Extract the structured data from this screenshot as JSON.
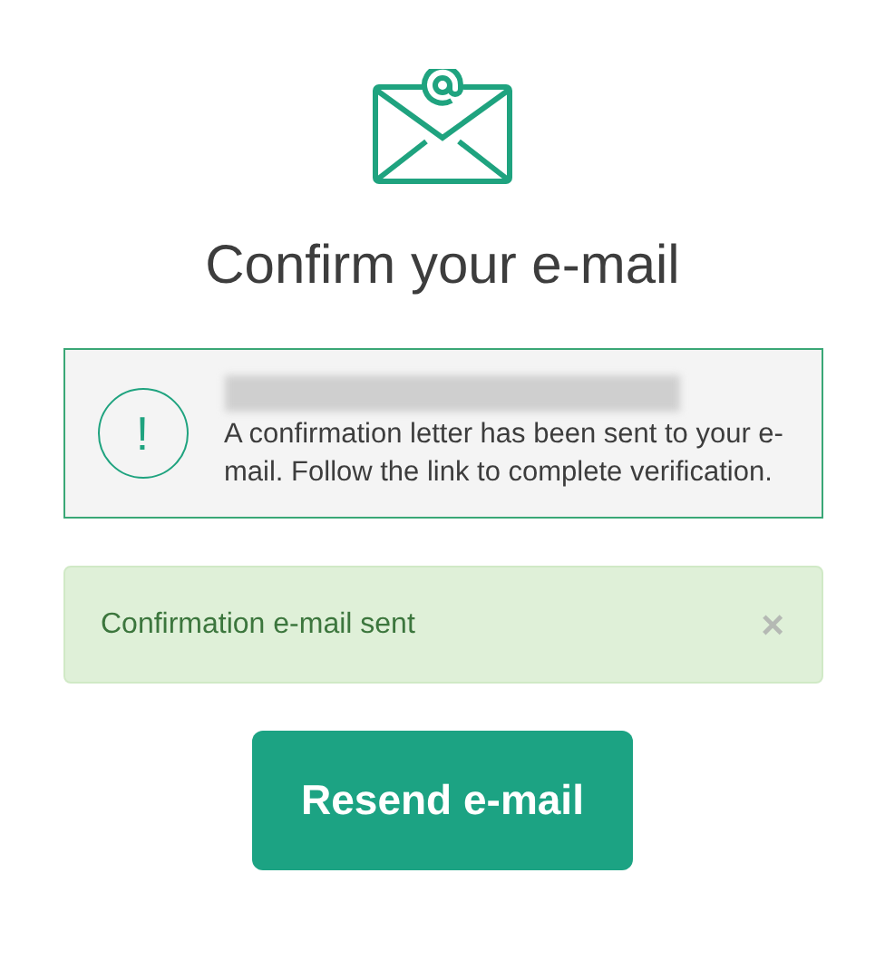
{
  "title": "Confirm your e-mail",
  "notice": {
    "icon": "!",
    "email_blurred": true,
    "message": "A confirmation letter has been sent to your e-mail. Follow the link to complete verification."
  },
  "alert": {
    "text": "Confirmation e-mail sent",
    "close": "×"
  },
  "button": {
    "label": "Resend e-mail"
  }
}
